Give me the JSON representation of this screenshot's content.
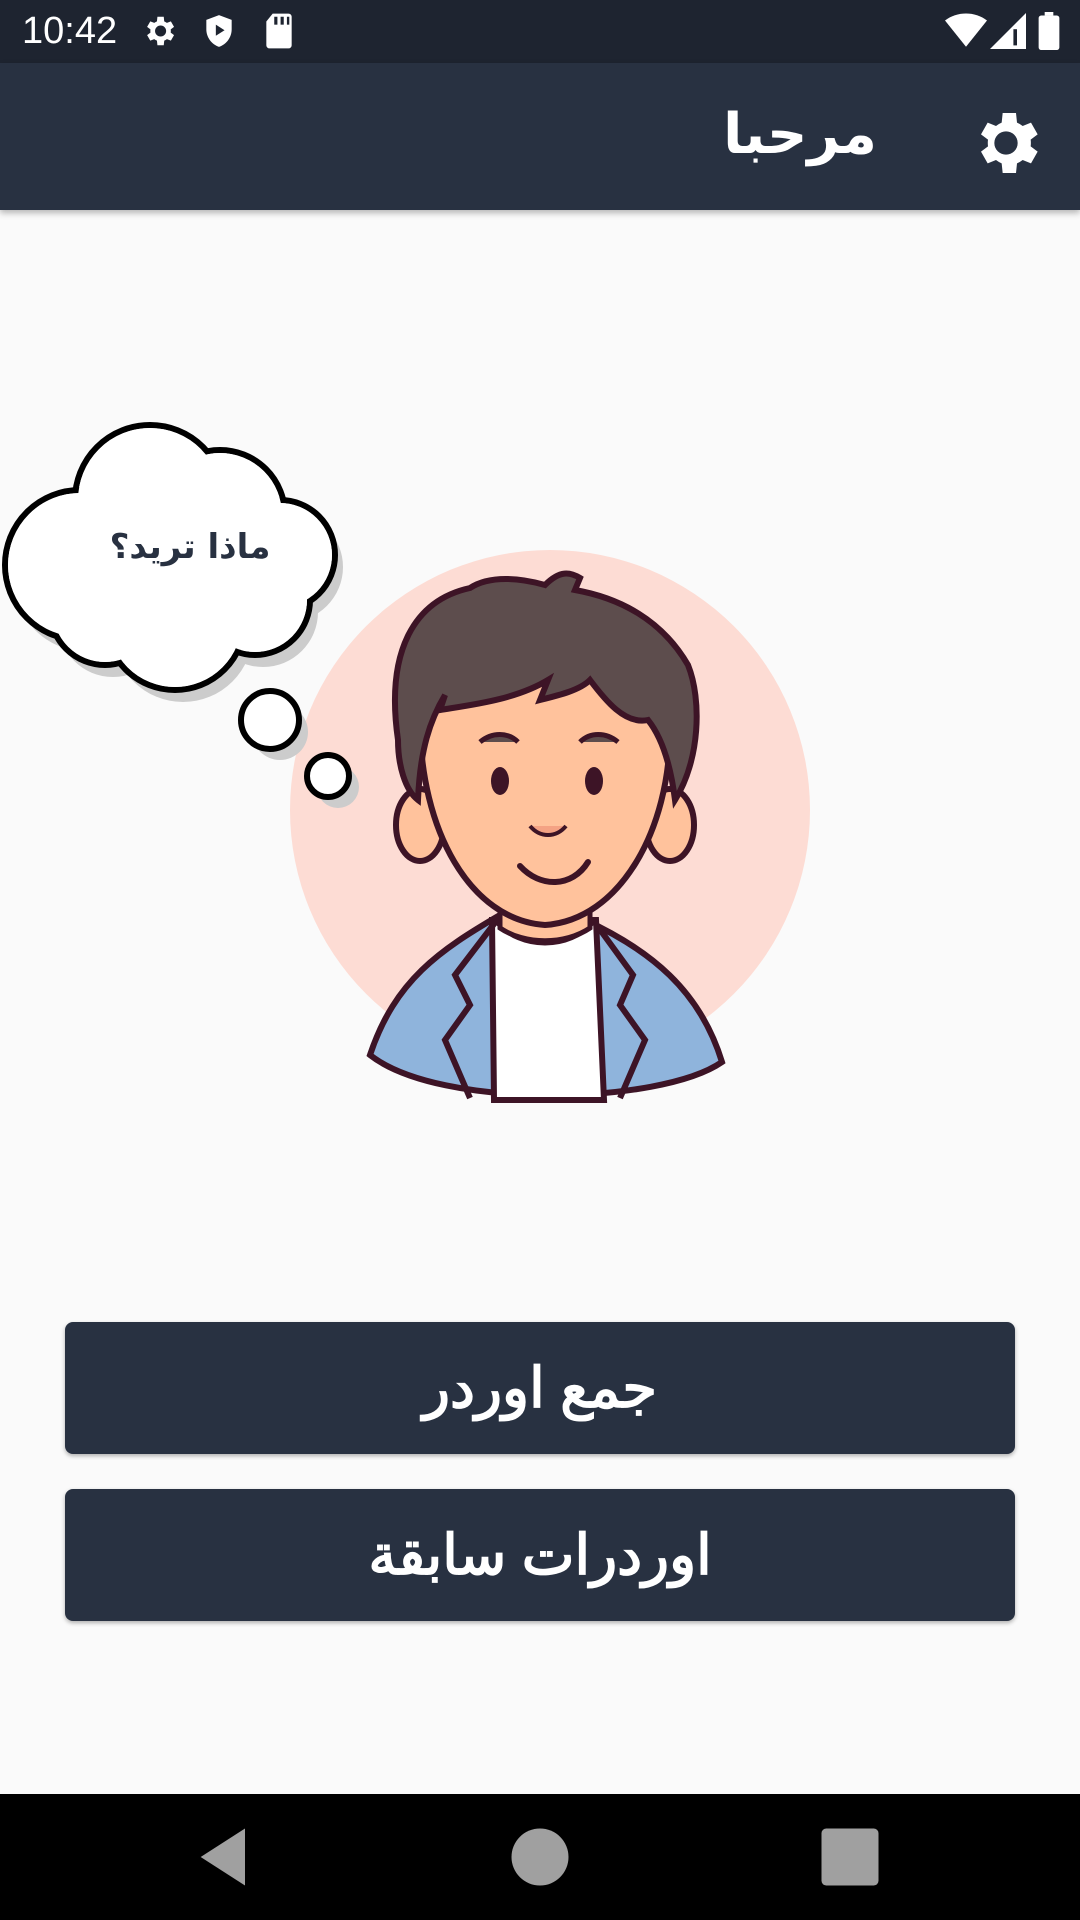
{
  "status_bar": {
    "time": "10:42",
    "left_icons": [
      "gear-icon",
      "shield-play-icon",
      "sd-card-icon"
    ],
    "right_icons": [
      "wifi-icon",
      "signal-icon",
      "battery-icon"
    ]
  },
  "app_bar": {
    "title": "مرحبا",
    "settings_icon": "gear-icon",
    "background": "#283141"
  },
  "illustration": {
    "thought_bubble_text": "ماذا تريد؟",
    "circle_color": "#fddcd4",
    "jacket_color": "#8fb4dc",
    "skin_color": "#ffc29c",
    "hair_color": "#5d4d4d"
  },
  "actions": {
    "collect_order_label": "جمع اوردر",
    "previous_orders_label": "اوردرات سابقة"
  },
  "nav_bar": {
    "icons": [
      "back-triangle-icon",
      "home-circle-icon",
      "recents-square-icon"
    ]
  }
}
